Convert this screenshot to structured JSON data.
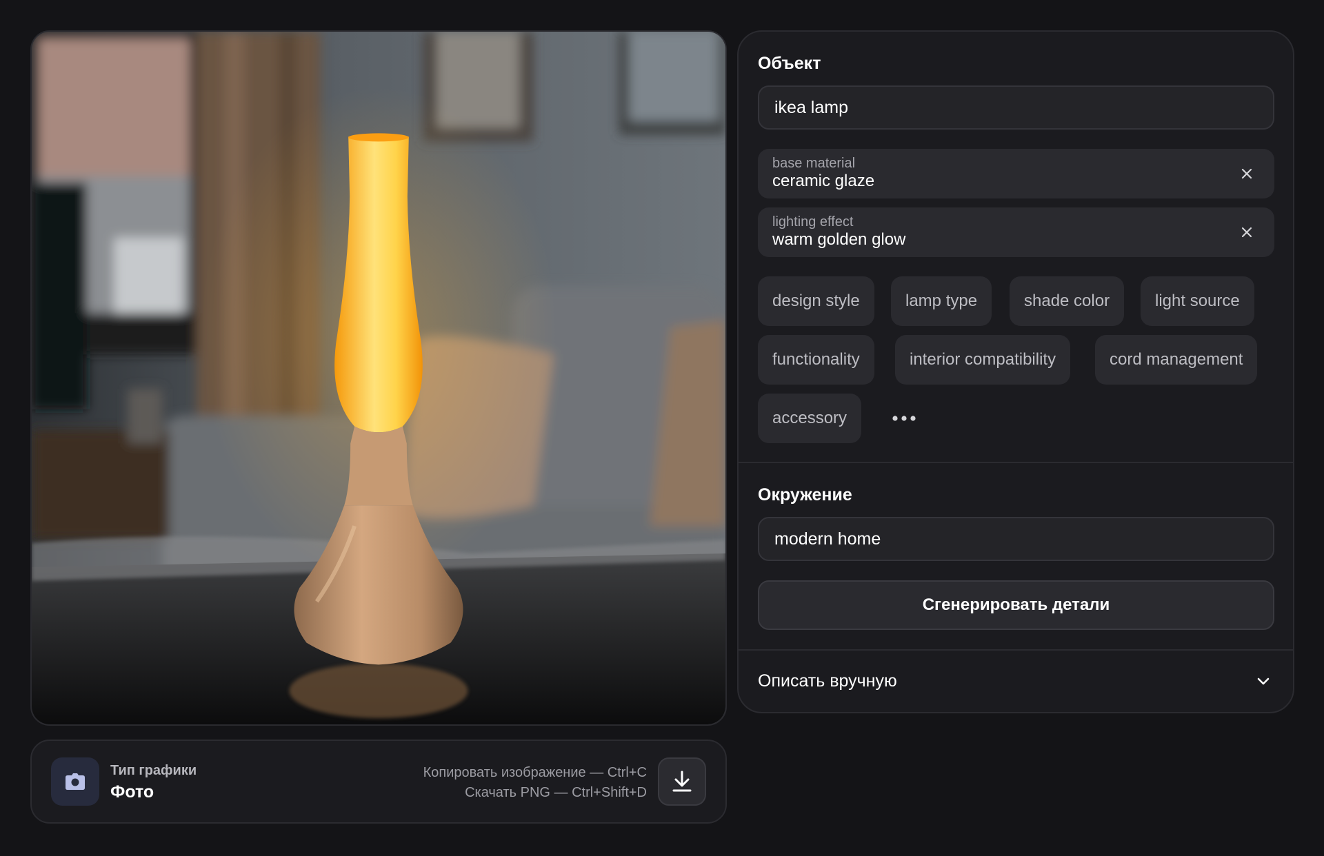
{
  "object_section": {
    "title": "Объект",
    "value": "ikea lamp",
    "selected": [
      {
        "key": "base material",
        "value": "ceramic glaze"
      },
      {
        "key": "lighting effect",
        "value": "warm golden glow"
      }
    ],
    "suggestions": [
      "design style",
      "lamp type",
      "shade color",
      "light source",
      "functionality",
      "interior compatibility",
      "cord management",
      "accessory"
    ],
    "more_icon": "more-dots-icon"
  },
  "environment_section": {
    "title": "Окружение",
    "value": "modern home",
    "generate_label": "Сгенерировать детали"
  },
  "manual_section": {
    "label": "Описать вручную",
    "icon": "chevron-down-icon"
  },
  "graphic_type": {
    "label": "Тип графики",
    "value": "Фото",
    "icon": "camera-icon"
  },
  "shortcuts": {
    "copy": "Копировать изображение — Ctrl+C",
    "download": "Скачать PNG — Ctrl+Shift+D"
  },
  "colors": {
    "accent_badge": "#272b3d",
    "panel_bg": "#1b1b1f",
    "chip_bg": "#2a2a2f",
    "lamp_glow": "#f7a514"
  }
}
